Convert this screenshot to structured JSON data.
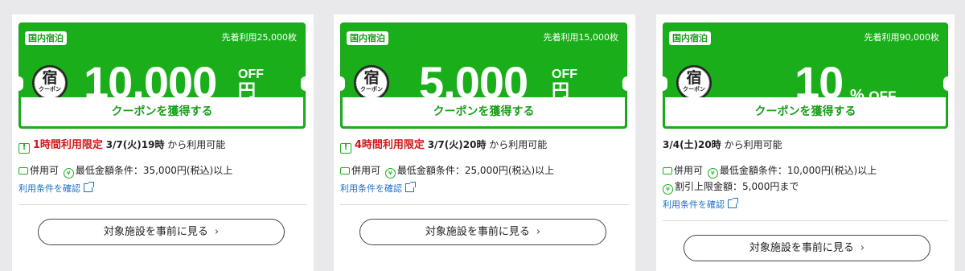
{
  "coupons": [
    {
      "tag": "国内宿泊",
      "first_come": "先着利用25,000枚",
      "amount": "10,000",
      "unit_off": "OFF",
      "unit_yen": "円",
      "logo_kanji": "宿",
      "logo_sub": "クーポン",
      "get_label": "クーポンを獲得する",
      "limit_text": "1時間利用限定",
      "start_time": "3/7(火)19時",
      "available_from": "から利用可能",
      "combinable": "併用可",
      "min_condition": "最低金額条件：35,000円(税込)以上",
      "terms_link": "利用条件を確認",
      "see_facilities": "対象施設を事前に見る"
    },
    {
      "tag": "国内宿泊",
      "first_come": "先着利用15,000枚",
      "amount": "5,000",
      "unit_off": "OFF",
      "unit_yen": "円",
      "logo_kanji": "宿",
      "logo_sub": "クーポン",
      "get_label": "クーポンを獲得する",
      "limit_text": "4時間利用限定",
      "start_time": "3/7(火)20時",
      "available_from": "から利用可能",
      "combinable": "併用可",
      "min_condition": "最低金額条件：25,000円(税込)以上",
      "terms_link": "利用条件を確認",
      "see_facilities": "対象施設を事前に見る"
    },
    {
      "tag": "国内宿泊",
      "first_come": "先着利用90,000枚",
      "amount": "10",
      "unit_pct": "%",
      "unit_off": "OFF",
      "logo_kanji": "宿",
      "logo_sub": "クーポン",
      "get_label": "クーポンを獲得する",
      "start_time": "3/4(土)20時",
      "available_from": "から利用可能",
      "combinable": "併用可",
      "min_condition": "最低金額条件：10,000円(税込)以上",
      "max_discount": "割引上限金額：5,000円まで",
      "terms_link": "利用条件を確認",
      "see_facilities": "対象施設を事前に見る"
    }
  ],
  "colors": {
    "brand_green": "#1aaf1a",
    "limit_red": "#d01818",
    "link_blue": "#1a6fcc"
  },
  "icons": {
    "warning": "exclamation-box-icon",
    "ticket": "ticket-icon",
    "yen": "yen-circle-icon",
    "external": "external-link-icon",
    "chevron": "chevron-right-icon"
  }
}
